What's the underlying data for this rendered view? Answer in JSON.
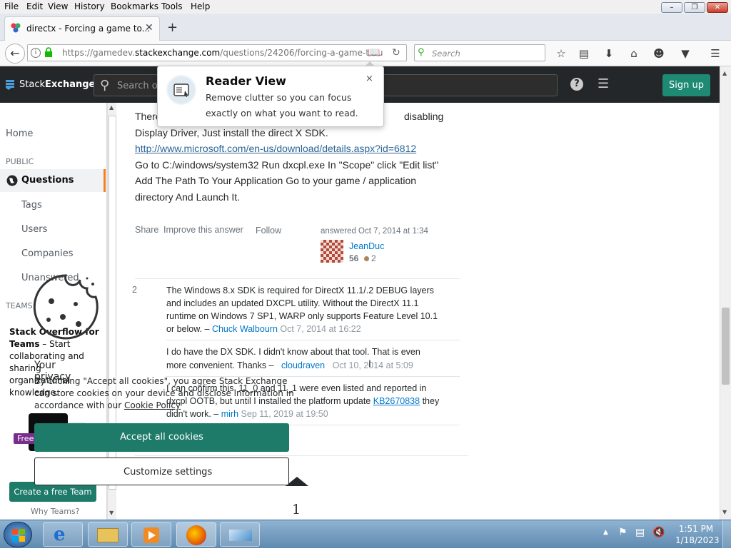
{
  "menu": [
    "File",
    "Edit",
    "View",
    "History",
    "Bookmarks",
    "Tools",
    "Help"
  ],
  "tab": {
    "title": "directx - Forcing a game to..."
  },
  "url": {
    "prefix": "https://gamedev.",
    "domain": "stackexchange.com",
    "path": "/questions/24206/forcing-a-game-to-u"
  },
  "search": {
    "placeholder": "Search"
  },
  "se": {
    "logo_a": "Stack",
    "logo_b": "Exchange",
    "search_placeholder": "Search or",
    "signup": "Sign up"
  },
  "reader": {
    "title": "Reader View",
    "body1": "Remove clutter so you can focus",
    "body2": "exactly on what you want to read.",
    "close": "×"
  },
  "sidebar": {
    "home": "Home",
    "public": "PUBLIC",
    "questions": "Questions",
    "tags": "Tags",
    "users": "Users",
    "companies": "Companies",
    "unanswered": "Unanswered",
    "teams": "TEAMS",
    "teams_promo_bold": "Stack Overflow for Teams",
    "teams_promo_rest": " – Start collaborating and sharing organizational knowledge.",
    "free": "Free",
    "create_team": "Create a free Team",
    "why_teams": "Why Teams?"
  },
  "answer": {
    "line1a": "There",
    "line1b": "disabling",
    "line2": "Display Driver, Just install the direct X SDK.",
    "link": "http://www.microsoft.com/en-us/download/details.aspx?id=6812",
    "line4": "Go to C:/windows/system32 Run dxcpl.exe In \"Scope\" click \"Edit list\"",
    "line5": "Add The Path To Your Application Go to your game / application",
    "line6": "directory And Launch It.",
    "share": "Share",
    "improve": "Improve this answer",
    "follow": "Follow",
    "answered": "answered Oct 7, 2014 at 1:34",
    "user": "JeanDuc",
    "rep": "56",
    "bronze": "2"
  },
  "comments": [
    {
      "score": "2",
      "l1": "The Windows 8.x SDK is required for DirectX 11.1/.2 DEBUG layers",
      "l2": "and includes an updated DXCPL utility. Without the DirectX 11.1",
      "l3": "runtime on Windows 7 SP1, WARP only supports Feature Level 10.1",
      "l4": "or below. –",
      "user": "Chuck Walbourn",
      "date": "Oct 7, 2014 at 16:22"
    },
    {
      "score": "",
      "l1": "I do have the DX SDK. I didn't know about that tool. That is even",
      "l2": "more convenient. Thanks –",
      "user": "cloudraven",
      "date": "Oct 10, 2014 at 5:09"
    },
    {
      "score": "",
      "l1": "I can confirm this. 11_0 and 11_1 were even listed and reported in",
      "l2": "dxcpl OOTB, but until I installed the platform update",
      "link": "KB2670838",
      "l2b": "they",
      "l3": "didn't work. –",
      "user": "mirh",
      "date": "Sep 11, 2019 at 19:50"
    }
  ],
  "cookie": {
    "title": "Your privacy",
    "l1": "By clicking \"Accept all cookies\", you agree Stack Exchange",
    "l2": "can store cookies on your device and disclose information in",
    "l3": "accordance with our",
    "policy": "Cookie Policy",
    "accept": "Accept all cookies",
    "customize": "Customize settings"
  },
  "page_number": "1",
  "clock": {
    "time": "1:51 PM",
    "date": "1/18/2023"
  },
  "colors": {
    "se_header": "#242729",
    "signup": "#1e8a73",
    "accept": "#1e7a69",
    "link": "#0077cc"
  }
}
